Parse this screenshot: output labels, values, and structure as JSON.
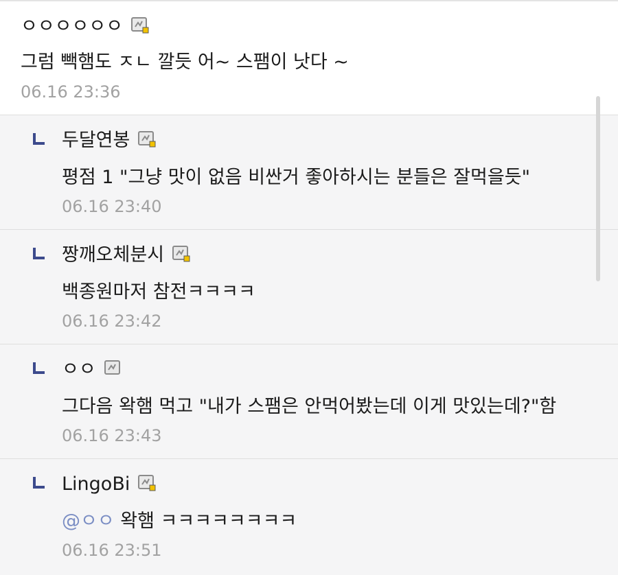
{
  "comments": [
    {
      "nickname": "ㅇㅇㅇㅇㅇㅇ",
      "text": "그럼 빽햄도 ㅈㄴ 깔듯 어~ 스팸이 낫다 ~",
      "time": "06.16 23:36"
    }
  ],
  "replies": [
    {
      "nickname": "두달연봉",
      "text": "평점 1 \"그냥 맛이 없음 비싼거 좋아하시는 분들은 잘먹을듯\"",
      "time": "06.16 23:40",
      "badge": "gallery-member-icon"
    },
    {
      "nickname": "짱깨오체분시",
      "text": "백종원마저 참전ㅋㅋㅋㅋ",
      "time": "06.16 23:42",
      "badge": "gallery-member-icon"
    },
    {
      "nickname": "ㅇㅇ",
      "text": "그다음 왁햄 먹고 \"내가 스팸은 안먹어봤는데 이게 맛있는데?\"함",
      "time": "06.16 23:43",
      "badge": "fixed-nick-icon"
    },
    {
      "nickname": "LingoBi",
      "mention": "@ㅇㅇ",
      "text": "왁햄 ㅋㅋㅋㅋㅋㅋㅋㅋ",
      "time": "06.16 23:51",
      "badge": "gallery-member-icon"
    }
  ],
  "colors": {
    "reply_background": "#f5f5f6",
    "reply_arrow": "#3c4a8c",
    "timestamp": "#a2a2a2",
    "mention": "#7b8ec4",
    "badge_accent": "#f2c200"
  }
}
